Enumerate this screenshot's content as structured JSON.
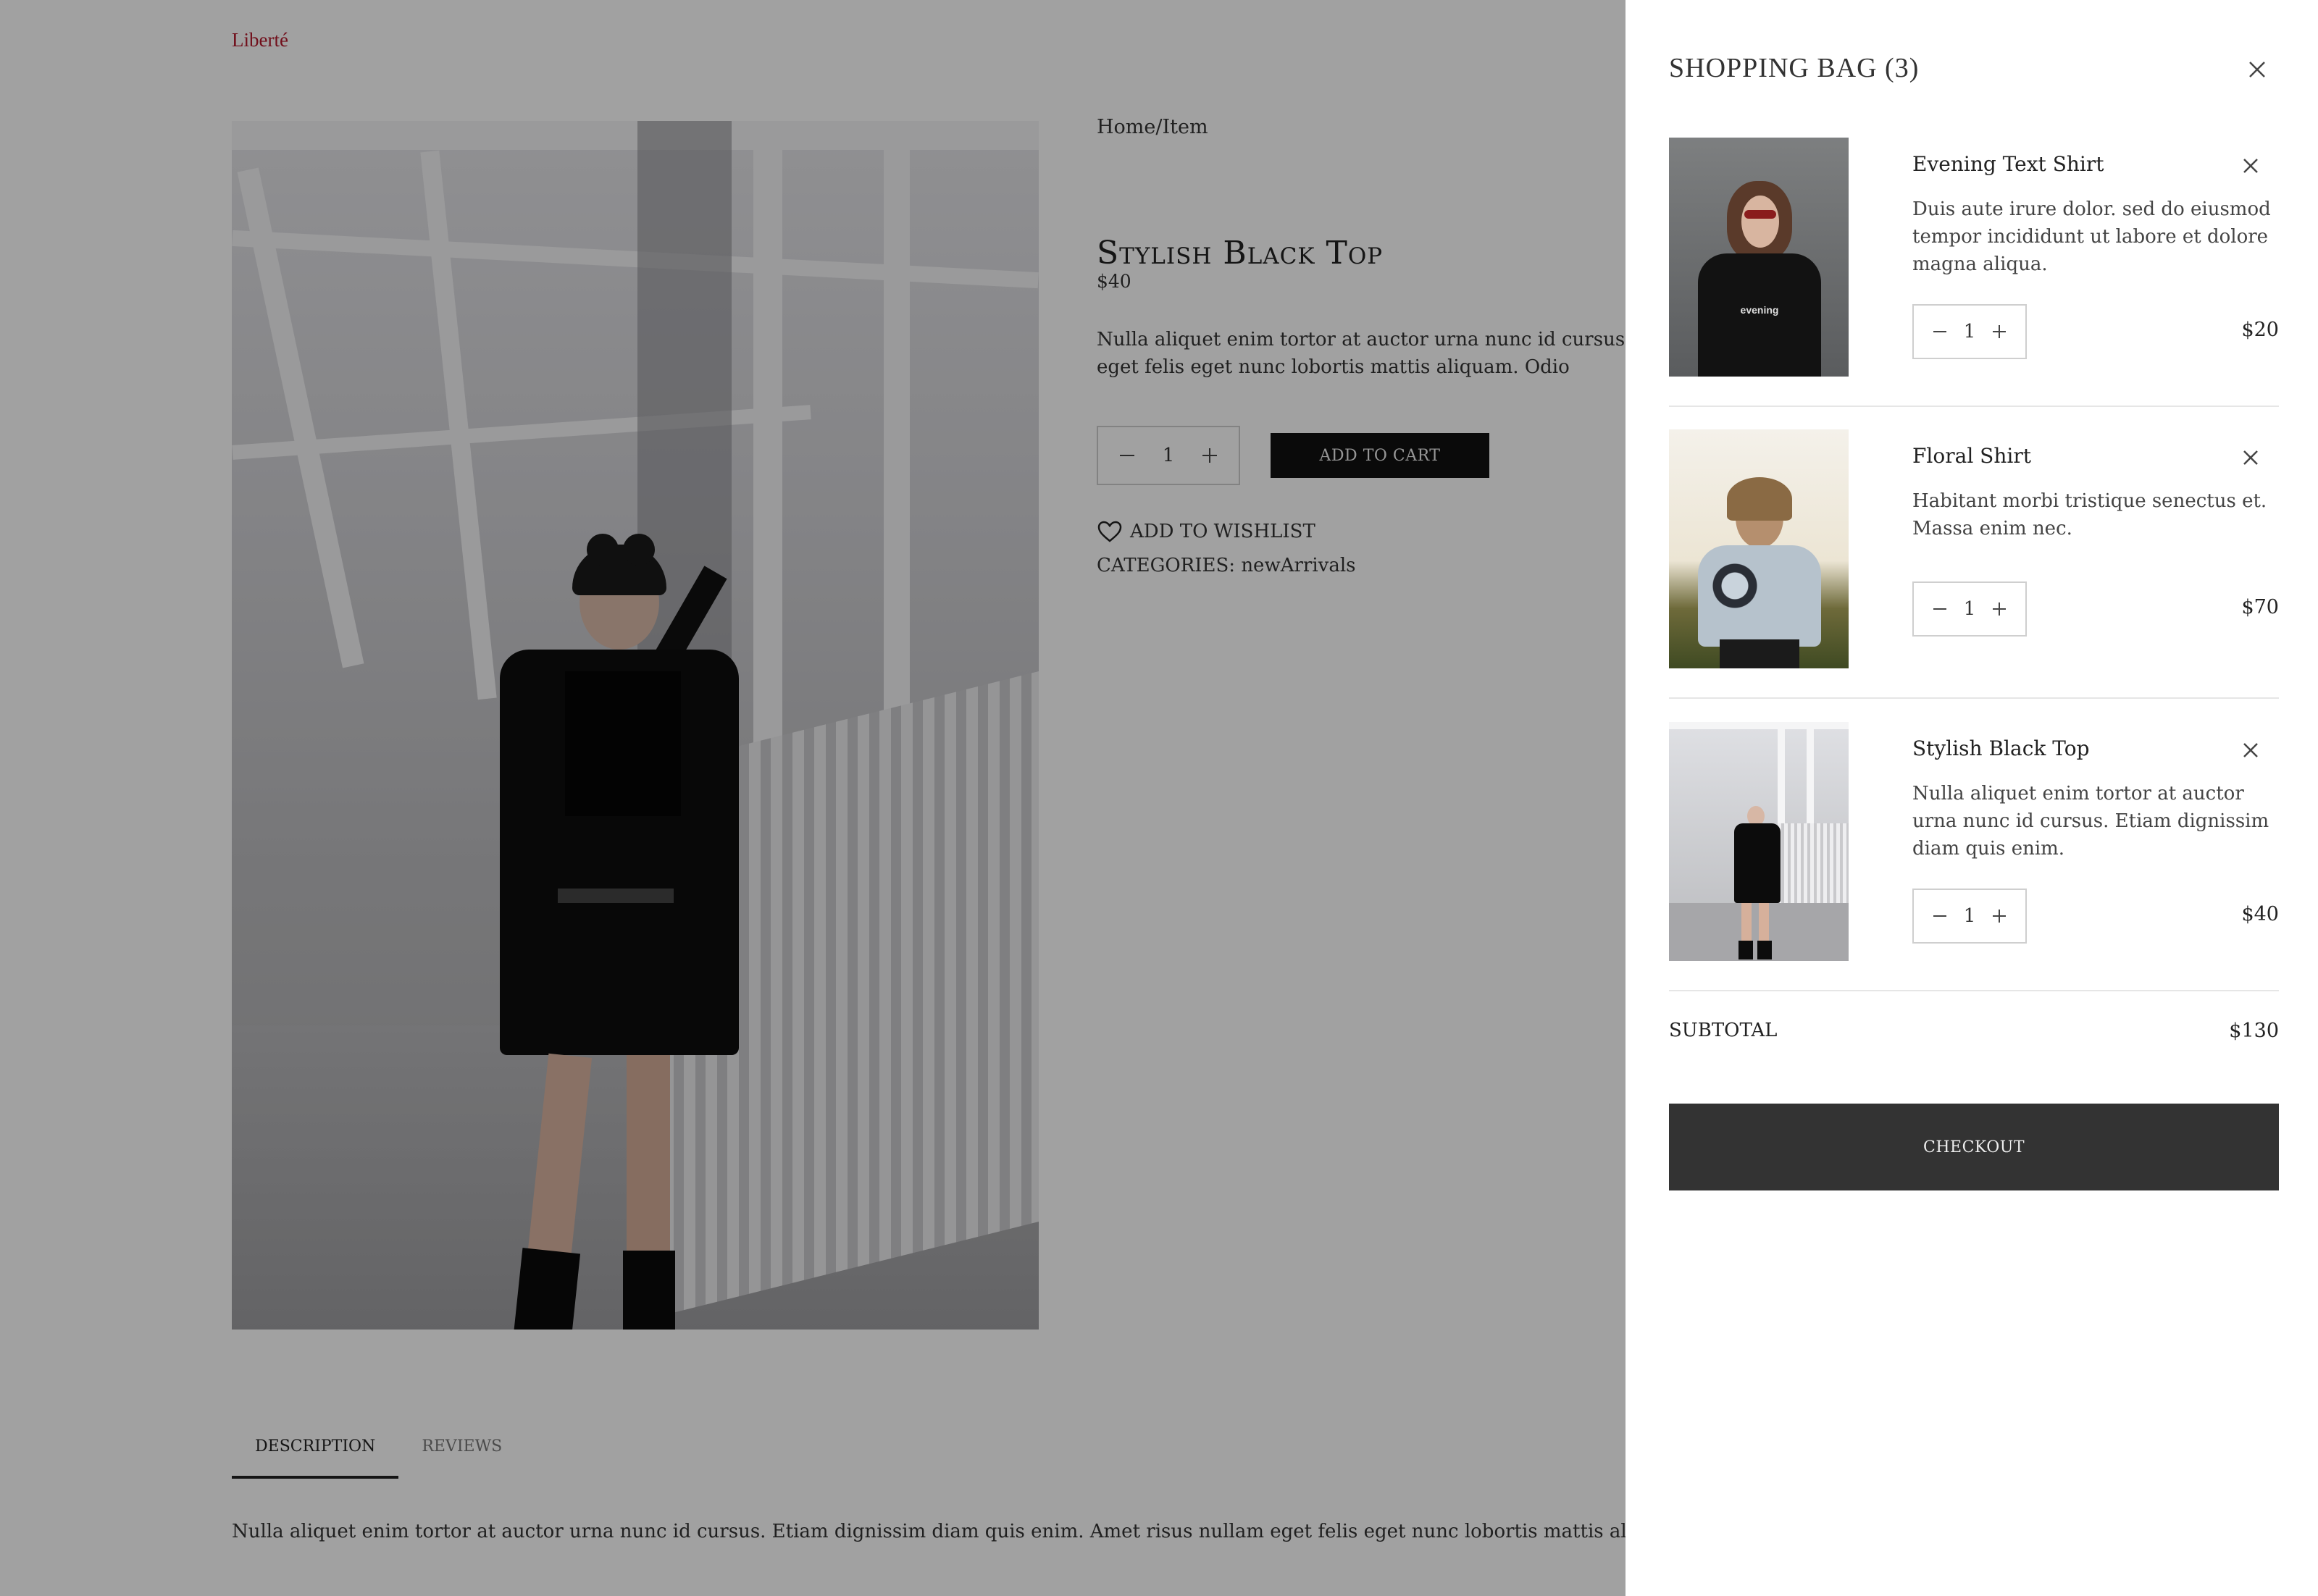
{
  "page": {
    "brand": "Liberté",
    "breadcrumb": "Home/Item",
    "product": {
      "title": "Stylish Black Top",
      "price": "$40",
      "description": "Nulla aliquet enim tortor at auctor urna nunc id cursus. E nullam eget felis eget nunc lobortis mattis aliquam. Odio",
      "quantity": "1",
      "add_to_cart": "ADD TO CART",
      "wishlist": "ADD TO WISHLIST",
      "categories": "CATEGORIES: newArrivals"
    },
    "tabs": [
      {
        "label": "DESCRIPTION",
        "active": true
      },
      {
        "label": "REVIEWS",
        "active": false
      }
    ],
    "tab_content": "Nulla aliquet enim tortor at auctor urna nunc id cursus. Etiam dignissim diam quis enim. Amet risus nullam eget felis eget nunc lobortis mattis aliqua volutpat."
  },
  "cart": {
    "title": "SHOPPING BAG (3)",
    "items": [
      {
        "name": "Evening Text Shirt",
        "description": "Duis aute irure dolor. sed do eiusmod tempor incididunt ut labore et dolore magna aliqua.",
        "quantity": "1",
        "price": "$20",
        "thumb_text": "evening"
      },
      {
        "name": "Floral Shirt",
        "description": "Habitant morbi tristique senectus et. Massa enim nec.",
        "quantity": "1",
        "price": "$70"
      },
      {
        "name": "Stylish Black Top",
        "description": "Nulla aliquet enim tortor at auctor urna nunc id cursus. Etiam dignissim diam quis enim.",
        "quantity": "1",
        "price": "$40"
      }
    ],
    "subtotal_label": "SUBTOTAL",
    "subtotal_value": "$130",
    "checkout_label": "CHECKOUT"
  },
  "colors": {
    "brand": "#b3182b",
    "button_dark": "#111111",
    "checkout": "#333333",
    "overlay": "rgba(0,0,0,0.37)"
  },
  "icons": {
    "close": "close-icon",
    "minus": "minus-icon",
    "plus": "plus-icon",
    "heart": "heart-icon"
  }
}
